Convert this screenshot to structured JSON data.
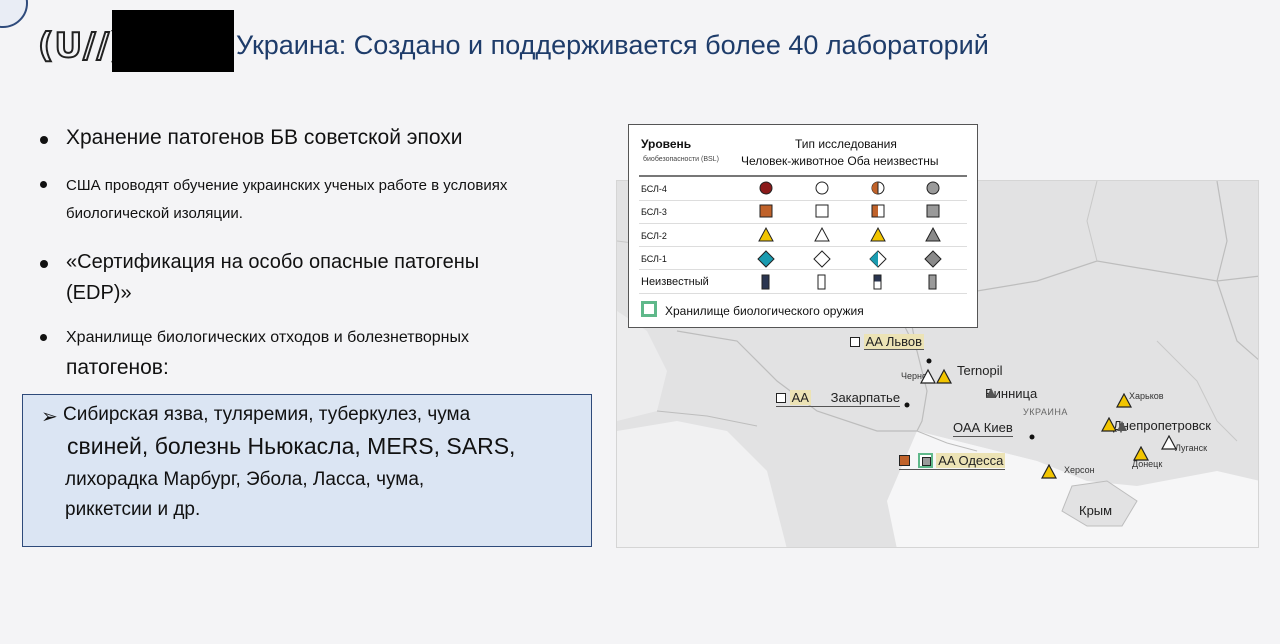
{
  "header": {
    "logo_text": "(U//)",
    "title": "Украина: Создано и поддерживается более 40 лабораторий"
  },
  "bullets": [
    "Хранение патогенов БВ советской эпохи",
    "США проводят обучение украинских ученых работе в условиях",
    "биологической изоляции.",
    "«Сертификация на особо опасные патогены",
    "(EDP)»",
    "Хранилище биологических отходов и болезнетворных",
    "патогенов:"
  ],
  "callout": {
    "lines": [
      "Сибирская язва, туляремия, туберкулез, чума",
      "свиней, болезнь Ньюкасла, MERS, SARS,",
      "лихорадка Марбург, Эбола, Ласса, чума,",
      "риккетсии и др."
    ]
  },
  "legend": {
    "header_level": "Уровень",
    "header_bsl": "биобезопасности (BSL)",
    "header_type": "Тип исследования",
    "col_labels": "Человек-животное Оба неизвестны",
    "rows": [
      "БСЛ-4",
      "БСЛ-3",
      "БСЛ-2",
      "БСЛ-1",
      "Неизвестный"
    ],
    "storage": "Хранилище биологического оружия",
    "colors": {
      "human": "#8b1a1a",
      "human_bsl3": "#c0622a",
      "human_bsl2": "#f2c500",
      "human_bsl1": "#1a9bb0",
      "unknown": "#9a9a9a",
      "unknown_level": "#2a3550",
      "storage_green": "#5fb88a"
    }
  },
  "map": {
    "labels": {
      "lviv": "AA Львов",
      "chernov": "Чернов",
      "ternopil": "Ternopil",
      "vinnitsa": "Винница",
      "ukraine": "УКРАИНА",
      "aa_zak": "AA",
      "zakarpatye": "Закарпатье",
      "kiev": "ОАА Киев",
      "kharkov": "Харьков",
      "dnepr": "Днепропетровск",
      "lugansk": "Луганск",
      "odessa": "AA Одесса",
      "kherson": "Херсон",
      "donetsk": "Донецк",
      "krym": "Крым"
    }
  }
}
